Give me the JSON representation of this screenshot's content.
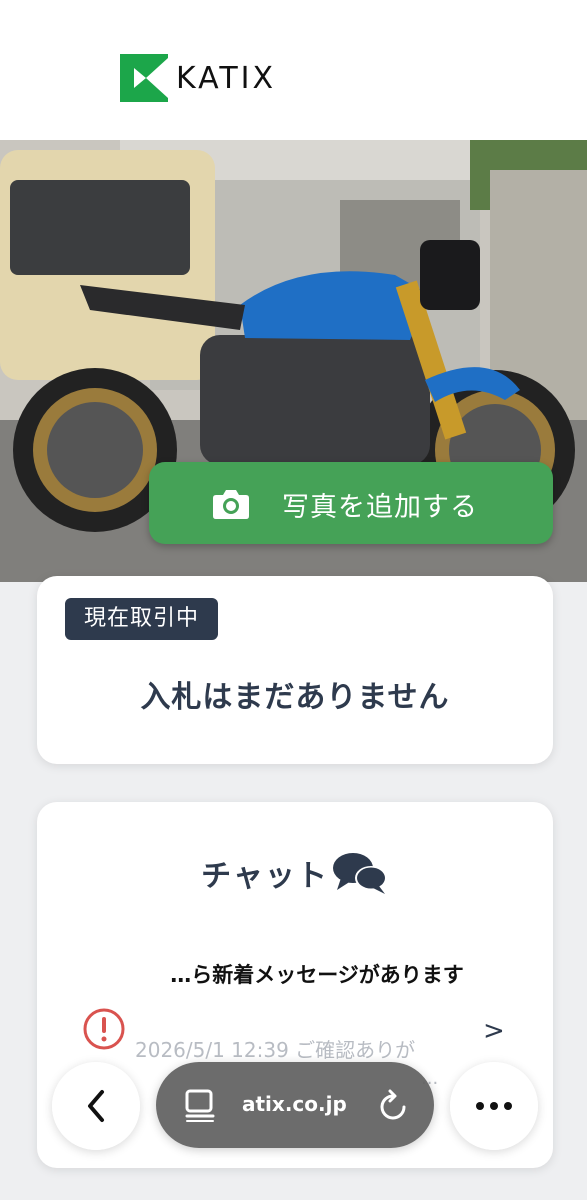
{
  "brand": {
    "name": "KATIX",
    "green": "#1ca64a"
  },
  "hero": {
    "alt_icon": "photo"
  },
  "add_photo": {
    "label": "写真を追加する",
    "icon": "camera-icon",
    "color": "#45a257"
  },
  "status_card": {
    "badge": "現在取引中",
    "message": "入札はまだありません"
  },
  "chat_card": {
    "title": "チャット",
    "icon": "chat-bubbles-icon",
    "message_prefix": "…",
    "message": "ら新着メッセージがあります",
    "meta": "2026/5/1 12:39 ご確認ありが",
    "ellipsis": "...",
    "arrow": ">"
  },
  "browser_bar": {
    "url": "atix.co.jp",
    "back_icon": "chevron-left-icon",
    "more_icon": "more-icon"
  }
}
